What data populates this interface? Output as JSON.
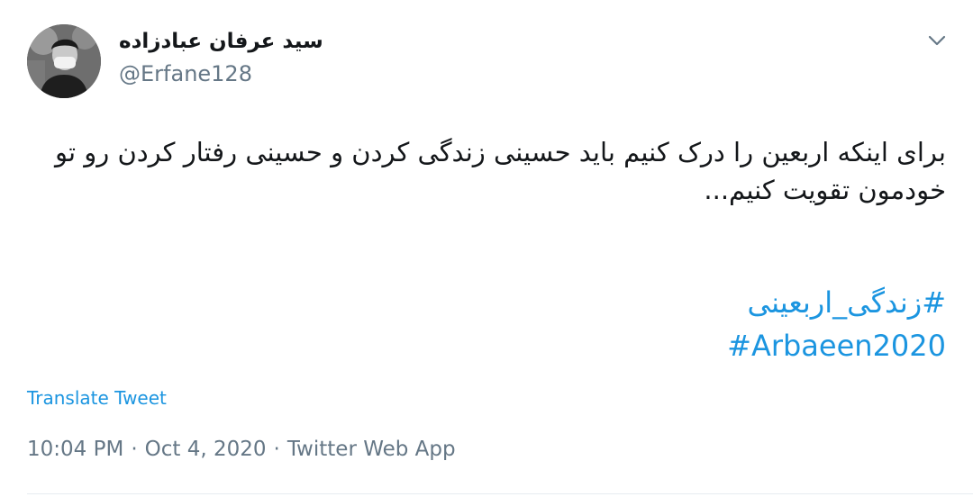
{
  "author": {
    "display_name": "سید عرفان عبادزاده",
    "handle": "@Erfane128"
  },
  "tweet": {
    "text": "برای اینکه اربعین را درک کنیم باید حسینی زندگی کردن و حسینی رفتار کردن رو تو خودمون تقویت کنیم...",
    "hashtags": [
      "#زندگی_اربعینی",
      "#Arbaeen2020"
    ]
  },
  "actions": {
    "translate_label": "Translate Tweet",
    "menu_icon": "chevron-down-icon"
  },
  "meta": {
    "time": "10:04 PM",
    "separator": "·",
    "date": "Oct 4, 2020",
    "source": "Twitter Web App"
  },
  "colors": {
    "link": "#1b95e0",
    "secondary_text": "#657786",
    "primary_text": "#14171a"
  }
}
